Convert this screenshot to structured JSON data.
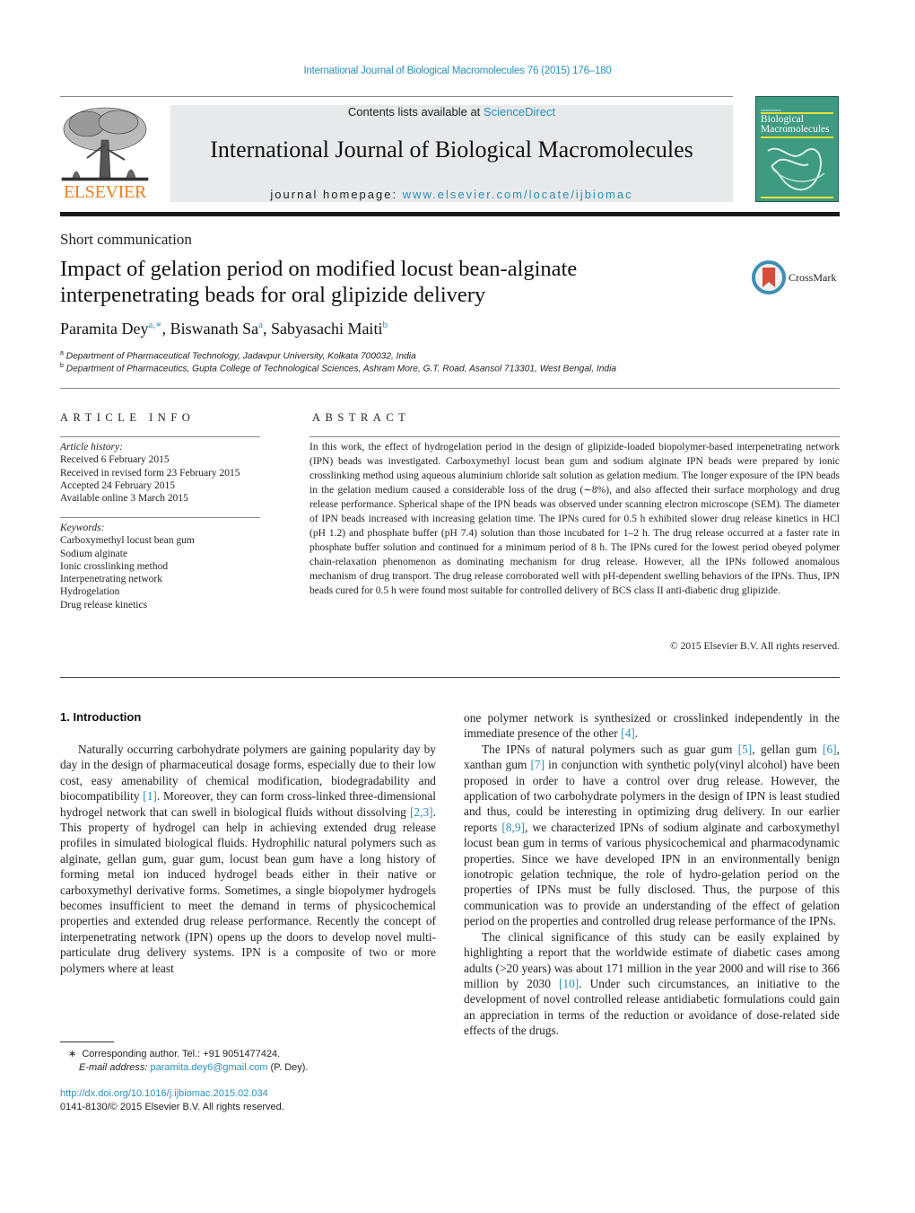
{
  "running_head": "International Journal of Biological Macromolecules 76 (2015) 176–180",
  "masthead": {
    "publisher_logo_text": "ELSEVIER",
    "contents_prefix": "Contents lists available at ",
    "contents_link": "ScienceDirect",
    "journal_title": "International Journal of Biological Macromolecules",
    "homepage_prefix": "journal homepage: ",
    "homepage_link": "www.elsevier.com/locate/ijbiomac",
    "cover_title_line1": "Biological",
    "cover_title_line2": "Macromolecules",
    "colors": {
      "link": "#2a8fbd",
      "elsevier_orange": "#f07d1e",
      "cover_green": "#3e9a80",
      "masthead_bg": "#e8e9ea"
    }
  },
  "article": {
    "type": "Short communication",
    "title_line1": "Impact of gelation period on modified locust bean-alginate",
    "title_line2": "interpenetrating beads for oral glipizide delivery",
    "crossmark_label": "CrossMark",
    "authors": [
      {
        "name": "Paramita Dey",
        "sup": "a,∗"
      },
      {
        "name": "Biswanath Sa",
        "sup": "a"
      },
      {
        "name": "Sabyasachi Maiti",
        "sup": "b"
      }
    ],
    "affiliations": [
      {
        "sup": "a",
        "text": "Department of Pharmaceutical Technology, Jadavpur University, Kolkata 700032, India"
      },
      {
        "sup": "b",
        "text": "Department of Pharmaceutics, Gupta College of Technological Sciences, Ashram More, G.T. Road, Asansol 713301, West Bengal, India"
      }
    ]
  },
  "article_info": {
    "heading": "ARTICLE INFO",
    "history_label": "Article history:",
    "history": [
      "Received 6 February 2015",
      "Received in revised form 23 February 2015",
      "Accepted 24 February 2015",
      "Available online 3 March 2015"
    ],
    "keywords_label": "Keywords:",
    "keywords": [
      "Carboxymethyl locust bean gum",
      "Sodium alginate",
      "Ionic crosslinking method",
      "Interpenetrating network",
      "Hydrogelation",
      "Drug release kinetics"
    ]
  },
  "abstract": {
    "heading": "ABSTRACT",
    "text": "In this work, the effect of hydrogelation period in the design of glipizide-loaded biopolymer-based interpenetrating network (IPN) beads was investigated. Carboxymethyl locust bean gum and sodium alginate IPN beads were prepared by ionic crosslinking method using aqueous aluminium chloride salt solution as gelation medium. The longer exposure of the IPN beads in the gelation medium caused a considerable loss of the drug (∼8%), and also affected their surface morphology and drug release performance. Spherical shape of the IPN beads was observed under scanning electron microscope (SEM). The diameter of IPN beads increased with increasing gelation time. The IPNs cured for 0.5 h exhibited slower drug release kinetics in HCl (pH 1.2) and phosphate buffer (pH 7.4) solution than those incubated for 1–2 h. The drug release occurred at a faster rate in phosphate buffer solution and continued for a minimum period of 8 h. The IPNs cured for the lowest period obeyed polymer chain-relaxation phenomenon as dominating mechanism for drug release. However, all the IPNs followed anomalous mechanism of drug transport. The drug release corroborated well with pH-dependent swelling behaviors of the IPNs. Thus, IPN beads cured for 0.5 h were found most suitable for controlled delivery of BCS class II anti-diabetic drug glipizide.",
    "copyright": "© 2015 Elsevier B.V. All rights reserved."
  },
  "body": {
    "section_heading": "1.  Introduction",
    "left_p1": [
      "Naturally occurring carbohydrate polymers are gaining popularity day by day in the design of pharmaceutical dosage forms, especially due to their low cost, easy amenability of chemical modification, biodegradability and biocompatibility ",
      "[1]",
      ". Moreover, they can form cross-linked three-dimensional hydrogel network that can swell in biological fluids without dissolving ",
      "[2,3]",
      ". This property of hydrogel can help in achieving extended drug release profiles in simulated biological fluids. Hydrophilic natural polymers such as alginate, gellan gum, guar gum, locust bean gum have a long history of forming metal ion induced hydrogel beads either in their native or carboxymethyl derivative forms. Sometimes, a single biopolymer hydrogels becomes insufficient to meet the demand in terms of physicochemical properties and extended drug release performance. Recently the concept of interpenetrating network (IPN) opens up the doors to develop novel multi-particulate drug delivery systems. IPN is a composite of two or more polymers where at least"
    ],
    "right_p0": [
      "one polymer network is synthesized or crosslinked independently in the immediate presence of the other ",
      "[4]",
      "."
    ],
    "right_p1": [
      "The IPNs of natural polymers such as guar gum ",
      "[5]",
      ", gellan gum ",
      "[6]",
      ", xanthan gum ",
      "[7]",
      " in conjunction with synthetic poly(vinyl alcohol) have been proposed in order to have a control over drug release. However, the application of two carbohydrate polymers in the design of IPN is least studied and thus, could be interesting in optimizing drug delivery. In our earlier reports ",
      "[8,9]",
      ", we characterized IPNs of sodium alginate and carboxymethyl locust bean gum in terms of various physicochemical and pharmacodynamic properties. Since we have developed IPN in an environmentally benign ionotropic gelation technique, the role of hydro-gelation period on the properties of IPNs must be fully disclosed. Thus, the purpose of this communication was to provide an understanding of the effect of gelation period on the properties and controlled drug release performance of the IPNs."
    ],
    "right_p2": [
      "The clinical significance of this study can be easily explained by highlighting a report that the worldwide estimate of diabetic cases among adults (>20 years) was about 171 million in the year 2000 and will rise to 366 million by 2030 ",
      "[10]",
      ". Under such circumstances, an initiative to the development of novel controlled release antidiabetic formulations could gain an appreciation in terms of the reduction or avoidance of dose-related side effects of the drugs."
    ]
  },
  "footnote": {
    "marker": "∗",
    "corresponding": "Corresponding author. Tel.: +91 9051477424.",
    "email_label": "E-mail address: ",
    "email": "paramita.dey6@gmail.com",
    "email_suffix": " (P. Dey).",
    "doi": "http://dx.doi.org/10.1016/j.ijbiomac.2015.02.034",
    "issn_line": "0141-8130/© 2015 Elsevier B.V. All rights reserved."
  }
}
